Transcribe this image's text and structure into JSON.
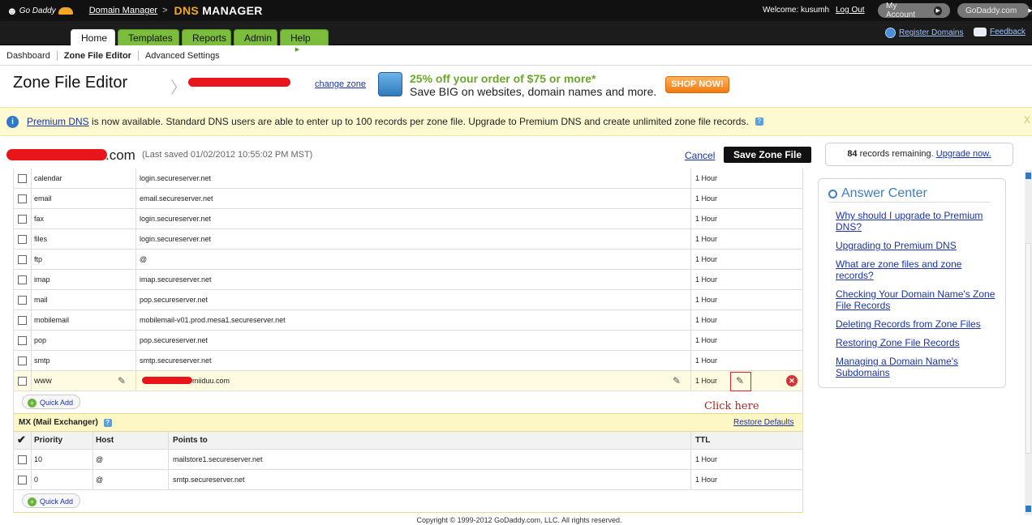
{
  "header": {
    "brand": "Go Daddy",
    "breadcrumb_link": "Domain Manager",
    "breadcrumb_sep": ">",
    "product_prefix": "DNS",
    "product_suffix": "MANAGER",
    "welcome": "Welcome: kusumh",
    "logout": "Log Out",
    "my_account": "My Account",
    "godaddy_com": "GoDaddy.com"
  },
  "nav": {
    "tabs": [
      {
        "label": "Home"
      },
      {
        "label": "Templates"
      },
      {
        "label": "Reports"
      },
      {
        "label": "Admin"
      },
      {
        "label": "Help"
      }
    ],
    "register_domains": "Register Domains",
    "feedback": "Feedback"
  },
  "subnav": {
    "items": [
      "Dashboard",
      "Zone File Editor",
      "Advanced Settings"
    ]
  },
  "page": {
    "title": "Zone File Editor",
    "change_zone": "change zone"
  },
  "promo": {
    "headline": "25% off your order of $75 or more*",
    "subline": "Save BIG on websites, domain names and more.",
    "button": "SHOP NOW!"
  },
  "notice": {
    "link": "Premium DNS",
    "text": " is now available. Standard DNS users are able to enter up to 100 records per zone file. Upgrade to Premium DNS and create unlimited zone file records.",
    "close": "X"
  },
  "zone": {
    "domain_suffix": ".com",
    "last_saved": "(Last saved 01/02/2012 10:55:02 PM MST)",
    "cancel": "Cancel",
    "save": "Save Zone File",
    "remaining_count": "84",
    "remaining_text": " records remaining. ",
    "upgrade": "Upgrade now."
  },
  "cname_rows": [
    {
      "host": "calendar",
      "points_to": "login.secureserver.net",
      "ttl": "1 Hour"
    },
    {
      "host": "email",
      "points_to": "email.secureserver.net",
      "ttl": "1 Hour"
    },
    {
      "host": "fax",
      "points_to": "login.secureserver.net",
      "ttl": "1 Hour"
    },
    {
      "host": "files",
      "points_to": "login.secureserver.net",
      "ttl": "1 Hour"
    },
    {
      "host": "ftp",
      "points_to": "@",
      "ttl": "1 Hour"
    },
    {
      "host": "imap",
      "points_to": "imap.secureserver.net",
      "ttl": "1 Hour"
    },
    {
      "host": "mail",
      "points_to": "pop.secureserver.net",
      "ttl": "1 Hour"
    },
    {
      "host": "mobilemail",
      "points_to": "mobilemail-v01.prod.mesa1.secureserver.net",
      "ttl": "1 Hour"
    },
    {
      "host": "pop",
      "points_to": "pop.secureserver.net",
      "ttl": "1 Hour"
    },
    {
      "host": "smtp",
      "points_to": "smtp.secureserver.net",
      "ttl": "1 Hour"
    }
  ],
  "www_row": {
    "host": "www",
    "points_to_suffix": "miiduu.com",
    "ttl": "1 Hour"
  },
  "quick_add": "Quick Add",
  "annotation": "Click here",
  "mx": {
    "title": "MX (Mail Exchanger)",
    "restore": "Restore Defaults",
    "columns": [
      "Priority",
      "Host",
      "Points to",
      "TTL"
    ],
    "rows": [
      {
        "priority": "10",
        "host": "@",
        "points_to": "mailstore1.secureserver.net",
        "ttl": "1 Hour"
      },
      {
        "priority": "0",
        "host": "@",
        "points_to": "smtp.secureserver.net",
        "ttl": "1 Hour"
      }
    ]
  },
  "answer_center": {
    "title": "Answer Center",
    "links": [
      "Why should I upgrade to Premium DNS?",
      "Upgrading to Premium DNS",
      "What are zone files and zone records?",
      "Checking Your Domain Name's Zone File Records",
      "Deleting Records from Zone Files",
      "Restoring Zone File Records",
      "Managing a Domain Name's Subdomains"
    ]
  },
  "footer": "Copyright © 1999-2012 GoDaddy.com, LLC. All rights reserved.",
  "colors": {
    "accent_orange": "#f5a623",
    "tab_green": "#7cbd3d",
    "link_blue": "#1a33a8",
    "notice_bg": "#fdf9d0"
  }
}
